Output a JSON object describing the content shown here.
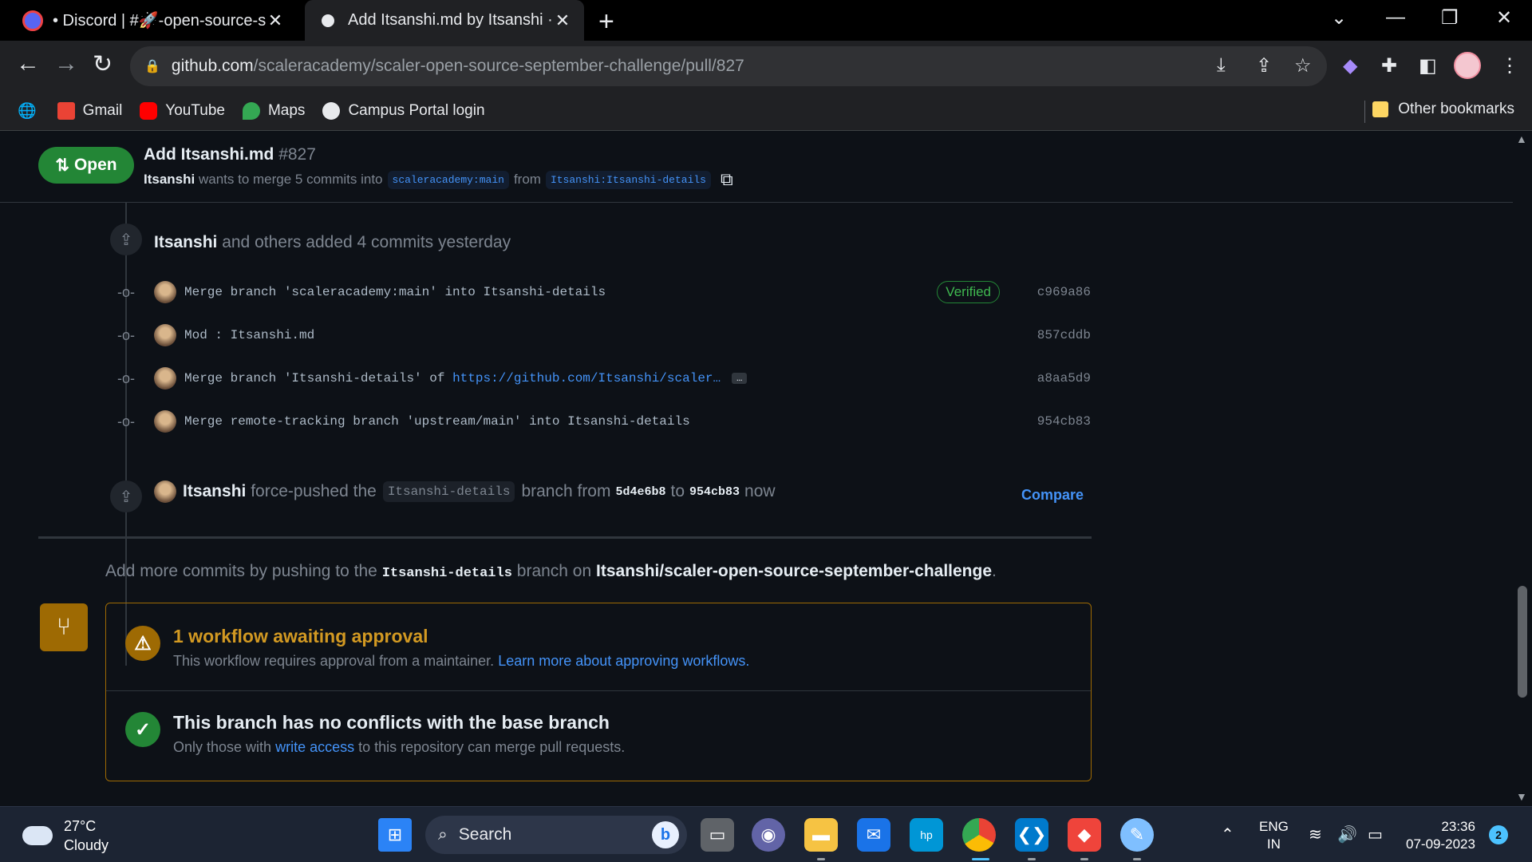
{
  "browser": {
    "tabs": [
      {
        "title": "• Discord | #🚀-open-source-sep",
        "close": "✕"
      },
      {
        "title": "Add Itsanshi.md by Itsanshi · Pull",
        "close": "✕"
      }
    ],
    "new_tab": "+",
    "url_host": "github.com",
    "url_path": "/scaleracademy/scaler-open-source-september-challenge/pull/827",
    "bookmarks": [
      "Gmail",
      "YouTube",
      "Maps",
      "Campus Portal login"
    ],
    "other_bookmarks": "Other bookmarks"
  },
  "pr": {
    "state": "Open",
    "title": "Add Itsanshi.md",
    "number": "#827",
    "author": "Itsanshi",
    "merge_text_1": "wants to merge 5 commits into",
    "base_branch": "scaleracademy:main",
    "from_text": "from",
    "head_branch": "Itsanshi:Itsanshi-details"
  },
  "timeline": {
    "commits_author": "Itsanshi",
    "commits_text": "and others added 4 commits yesterday",
    "commits": [
      {
        "message": "Merge branch 'scaleracademy:main' into Itsanshi-details",
        "sha": "c969a86",
        "verified": "Verified"
      },
      {
        "message": "Mod : Itsanshi.md",
        "sha": "857cddb"
      },
      {
        "message_prefix": "Merge branch 'Itsanshi-details' of ",
        "message_link": "https://github.com/Itsanshi/scaler…",
        "ellipsis": "…",
        "sha": "a8aa5d9"
      },
      {
        "message": "Merge remote-tracking branch 'upstream/main' into Itsanshi-details",
        "sha": "954cb83"
      }
    ],
    "force_push": {
      "author": "Itsanshi",
      "text1": "force-pushed the",
      "branch": "Itsanshi-details",
      "text2": "branch from",
      "from_sha": "5d4e6b8",
      "text3": "to",
      "to_sha": "954cb83",
      "time": "now",
      "compare": "Compare"
    }
  },
  "add_more": {
    "text1": "Add more commits by pushing to the",
    "branch": "Itsanshi-details",
    "text2": "branch on",
    "repo": "Itsanshi/scaler-open-source-september-challenge",
    "end": "."
  },
  "merge_box": {
    "workflow_title": "1 workflow awaiting approval",
    "workflow_desc": "This workflow requires approval from a maintainer.",
    "workflow_link": "Learn more about approving workflows.",
    "conflict_title": "This branch has no conflicts with the base branch",
    "conflict_desc_1": "Only those with",
    "conflict_link": "write access",
    "conflict_desc_2": "to this repository can merge pull requests."
  },
  "taskbar": {
    "temp": "27°C",
    "condition": "Cloudy",
    "search": "Search",
    "lang1": "ENG",
    "lang2": "IN",
    "time": "23:36",
    "date": "07-09-2023",
    "notifications": "2"
  },
  "colors": {
    "accent_green": "#238636",
    "link_blue": "#4493f8",
    "warn": "#d29922"
  }
}
